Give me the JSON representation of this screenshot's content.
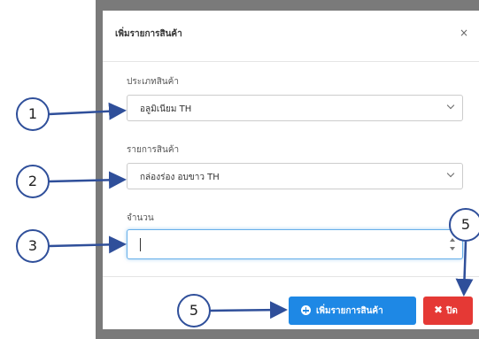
{
  "modal": {
    "title": "เพิ่มรายการสินค้า",
    "close_glyph": "×"
  },
  "fields": {
    "product_type": {
      "label": "ประเภทสินค้า",
      "value": "อลูมิเนียม TH"
    },
    "product_item": {
      "label": "รายการสินค้า",
      "value": "กล่องร่อง อบขาว TH"
    },
    "quantity": {
      "label": "จำนวน",
      "value": ""
    }
  },
  "footer": {
    "add_label": "เพิ่มรายการสินค้า",
    "close_label": "ปิด"
  },
  "annotations": {
    "badge_1": "1",
    "badge_2": "2",
    "badge_3": "3",
    "badge_5_top": "5",
    "badge_5_bottom": "5"
  },
  "colors": {
    "primary": "#1e88e5",
    "danger": "#e53935",
    "annotation": "#2f4f9a",
    "backdrop": "#7a7a7a"
  }
}
